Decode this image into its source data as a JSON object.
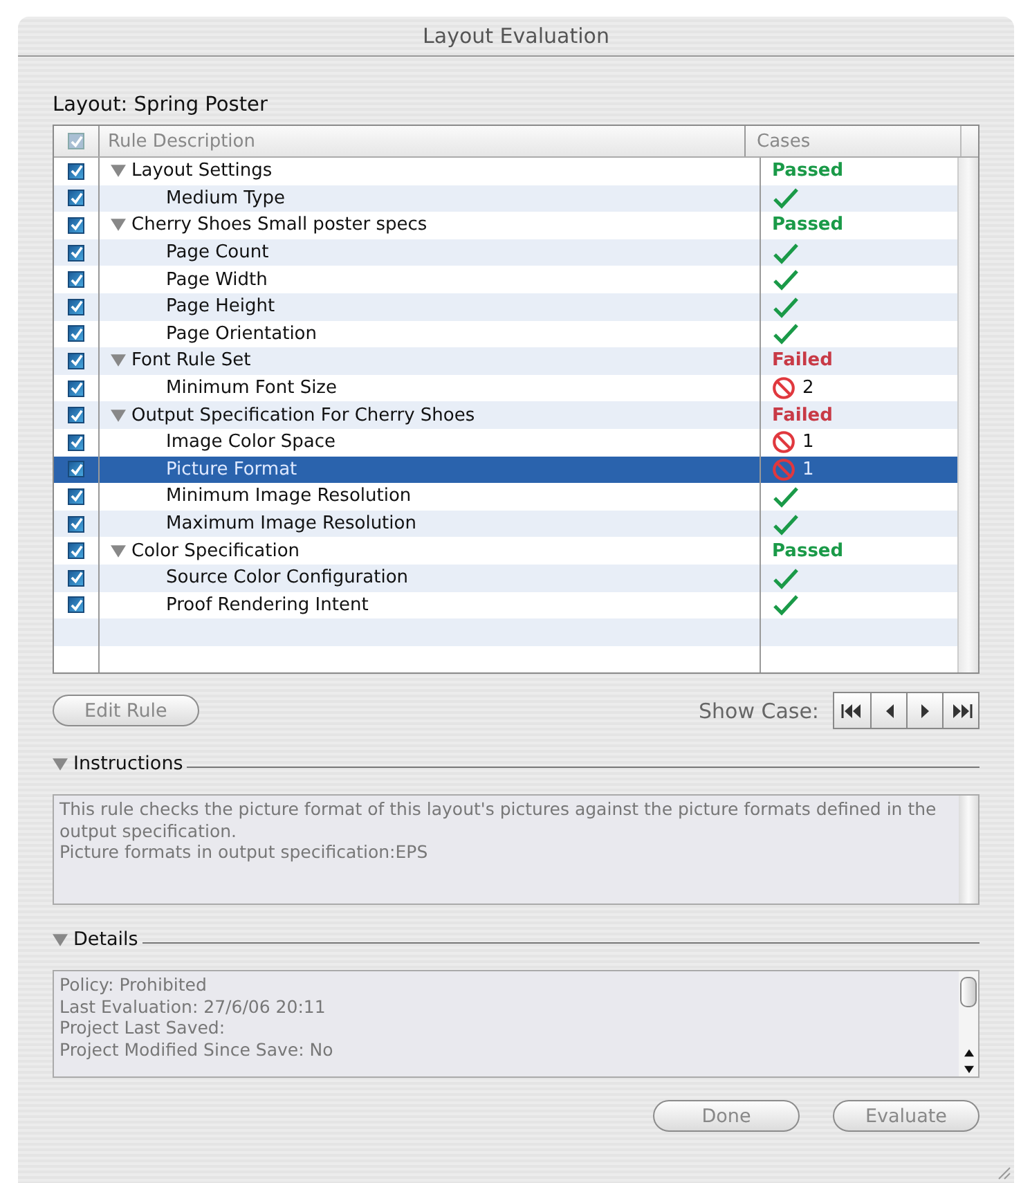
{
  "window": {
    "title": "Layout Evaluation"
  },
  "layout_label": "Layout: Spring Poster",
  "table": {
    "columns": [
      {
        "kind": "check",
        "checked": true
      },
      {
        "kind": "text",
        "label": "Rule Description"
      },
      {
        "kind": "text",
        "label": "Cases"
      }
    ],
    "rows": [
      {
        "label": "Layout Settings",
        "checked": true,
        "selected": false,
        "expanded": true,
        "result": {
          "kind": "passed",
          "text": "Passed"
        },
        "children": [
          {
            "label": "Medium Type",
            "checked": true,
            "selected": false,
            "result": {
              "kind": "ok"
            }
          }
        ]
      },
      {
        "label": "Cherry Shoes Small poster specs",
        "checked": true,
        "selected": false,
        "expanded": true,
        "result": {
          "kind": "passed",
          "text": "Passed"
        },
        "children": [
          {
            "label": "Page Count",
            "checked": true,
            "selected": false,
            "result": {
              "kind": "ok"
            }
          },
          {
            "label": "Page Width",
            "checked": true,
            "selected": false,
            "result": {
              "kind": "ok"
            }
          },
          {
            "label": "Page Height",
            "checked": true,
            "selected": false,
            "result": {
              "kind": "ok"
            }
          },
          {
            "label": "Page Orientation",
            "checked": true,
            "selected": false,
            "result": {
              "kind": "ok"
            }
          }
        ]
      },
      {
        "label": "Font Rule Set",
        "checked": true,
        "selected": false,
        "expanded": true,
        "result": {
          "kind": "failed",
          "text": "Failed"
        },
        "children": [
          {
            "label": "Minimum Font Size",
            "checked": true,
            "selected": false,
            "result": {
              "kind": "prohibited",
              "text": "2"
            }
          }
        ]
      },
      {
        "label": "Output Specification For Cherry Shoes",
        "checked": true,
        "selected": false,
        "expanded": true,
        "result": {
          "kind": "failed",
          "text": "Failed"
        },
        "children": [
          {
            "label": "Image Color Space",
            "checked": true,
            "selected": false,
            "result": {
              "kind": "prohibited",
              "text": "1"
            }
          },
          {
            "label": "Picture Format",
            "checked": true,
            "selected": true,
            "result": {
              "kind": "prohibited",
              "text": "1"
            }
          },
          {
            "label": "Minimum Image Resolution",
            "checked": true,
            "selected": false,
            "result": {
              "kind": "ok"
            }
          },
          {
            "label": "Maximum Image Resolution",
            "checked": true,
            "selected": false,
            "result": {
              "kind": "ok"
            }
          }
        ]
      },
      {
        "label": "Color Specification",
        "checked": true,
        "selected": false,
        "expanded": true,
        "result": {
          "kind": "passed",
          "text": "Passed"
        },
        "children": [
          {
            "label": "Source Color Configuration",
            "checked": true,
            "selected": false,
            "result": {
              "kind": "ok"
            }
          },
          {
            "label": "Proof Rendering Intent",
            "checked": true,
            "selected": false,
            "result": {
              "kind": "ok"
            }
          }
        ]
      }
    ]
  },
  "edit_button": {
    "label": "Edit Rule",
    "disabled": true
  },
  "show_case": {
    "label": "Show Case:"
  },
  "instructions": {
    "title": "Instructions",
    "expanded": true,
    "lines": [
      "This rule checks the picture format of this layout's pictures against the picture formats defined in the output specification.",
      "Picture formats in output specification:EPS"
    ]
  },
  "details": {
    "title": "Details",
    "expanded": true,
    "lines": [
      "Policy: Prohibited",
      "Last Evaluation: 27/6/06  20:11",
      "Project Last Saved:",
      "Project Modified Since Save: No"
    ]
  },
  "buttons": [
    {
      "label": "Done",
      "disabled": true
    },
    {
      "label": "Evaluate",
      "disabled": true
    }
  ]
}
